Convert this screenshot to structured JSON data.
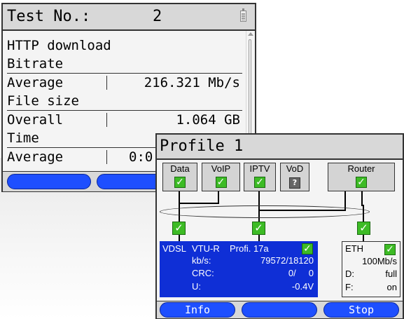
{
  "screen1": {
    "header": {
      "title": "Test No.:",
      "test_number": "2"
    },
    "heading": "HTTP download",
    "sections": [
      {
        "title": "Bitrate",
        "label": "Average",
        "value": "216.321 Mb/s"
      },
      {
        "title": "File size",
        "label": "Overall",
        "value": "1.064 GB"
      },
      {
        "title": "Time",
        "label": "Average",
        "value": "0:0"
      }
    ]
  },
  "screen2": {
    "title": "Profile 1",
    "services": [
      {
        "label": "Data",
        "status": "ok"
      },
      {
        "label": "VoIP",
        "status": "ok"
      },
      {
        "label": "IPTV",
        "status": "ok"
      },
      {
        "label": "VoD",
        "status": "unknown"
      },
      {
        "label": "Router",
        "status": "ok"
      }
    ],
    "vdsl": {
      "type": "VDSL",
      "mode": "VTU-R",
      "profile": "Profi. 17a",
      "rows": [
        {
          "label": "kb/s:",
          "value": "79572/18120"
        },
        {
          "label": "CRC:",
          "value": "0/     0"
        },
        {
          "label": "U:",
          "value": "-0.4V"
        }
      ]
    },
    "eth": {
      "label": "ETH",
      "speed": "100Mb/s",
      "rows": [
        {
          "label": "D:",
          "value": "full"
        },
        {
          "label": "F:",
          "value": "on"
        }
      ]
    },
    "softkeys": {
      "left": "Info",
      "middle": "",
      "right": "Stop"
    }
  },
  "colors": {
    "softkey": "#1e4fff",
    "vdsl_panel": "#0f2fd6",
    "check": "#3dbb25"
  }
}
